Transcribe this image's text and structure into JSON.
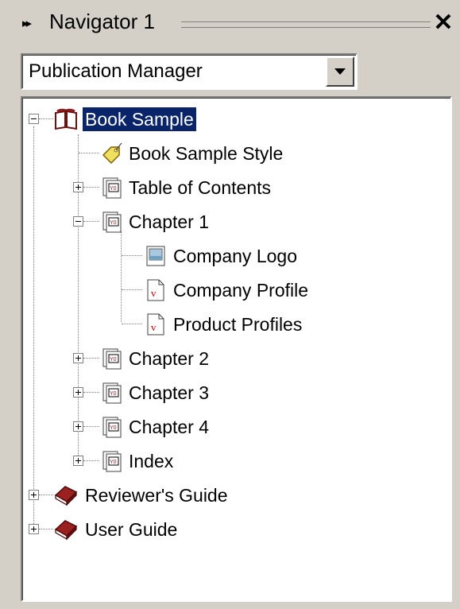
{
  "panel": {
    "title": "Navigator 1",
    "collapse_glyph": "▸▸",
    "close_glyph": "✕"
  },
  "dropdown": {
    "value": "Publication Manager"
  },
  "tree": {
    "root": {
      "label": "Book Sample",
      "icon": "open-book-icon",
      "expanded": true,
      "selected": true,
      "children": [
        {
          "label": "Book Sample Style",
          "icon": "tag-icon"
        },
        {
          "label": "Table of Contents",
          "icon": "chapter-doc-icon",
          "expanded": false
        },
        {
          "label": "Chapter 1",
          "icon": "chapter-doc-icon",
          "expanded": true,
          "children": [
            {
              "label": "Company Logo",
              "icon": "image-file-icon"
            },
            {
              "label": "Company Profile",
              "icon": "v-document-icon"
            },
            {
              "label": "Product Profiles",
              "icon": "v-document-icon"
            }
          ]
        },
        {
          "label": "Chapter 2",
          "icon": "chapter-doc-icon",
          "expanded": false
        },
        {
          "label": "Chapter 3",
          "icon": "chapter-doc-icon",
          "expanded": false
        },
        {
          "label": "Chapter 4",
          "icon": "chapter-doc-icon",
          "expanded": false
        },
        {
          "label": "Index",
          "icon": "chapter-doc-icon",
          "expanded": false
        }
      ]
    },
    "siblings": [
      {
        "label": "Reviewer's Guide",
        "icon": "closed-book-icon",
        "expanded": false
      },
      {
        "label": "User Guide",
        "icon": "closed-book-icon",
        "expanded": false
      }
    ]
  },
  "colors": {
    "panel_bg": "#d4d0c8",
    "selection_bg": "#0a246a",
    "selection_fg": "#ffffff",
    "book_red": "#8b1a1a"
  }
}
